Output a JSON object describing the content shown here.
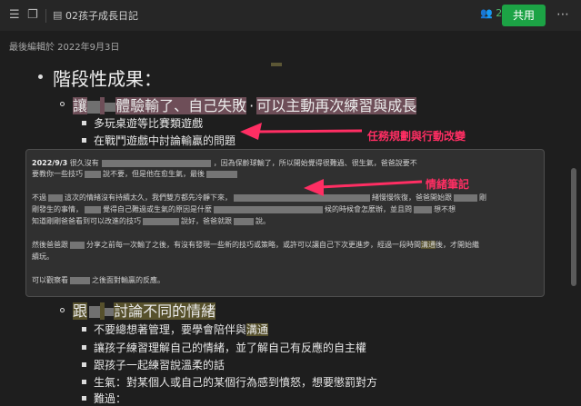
{
  "header": {
    "doc_title": "02孩子成長日記",
    "collaborators_count": "2",
    "share_label": "共用"
  },
  "last_edited": "最後編輯於 2022年9月3日",
  "outline": {
    "heading": "階段性成果：",
    "sub1": {
      "pre": "讓",
      "mid": "體驗輸了、自己失敗",
      "sep": "·",
      "post": "可以主動再次練習與成長"
    },
    "sub1_items": [
      "多玩桌遊等比賽類遊戲",
      "在戰鬥遊戲中討論輸贏的問題"
    ],
    "sub2": {
      "pre": "跟",
      "post": "討論不同的情緒"
    },
    "sub2_items": [
      "不要總想著管理，要學會陪伴與",
      "讓孩子練習理解自己的情緒，並了解自己有反應的自主權",
      "跟孩子一起練習說溫柔的話",
      "生氣：對某個人或自己的某個行為感到憤怒，想要懲罰對方",
      "難過："
    ],
    "sub2_hl": "溝通"
  },
  "note": {
    "date": "2022/9/3",
    "line1a": "很久沒有",
    "line1b": "，因為保齡球輸了，所以開始覺得很難過、很生氣，爸爸說要不",
    "line2a": "要教你一些技巧",
    "line2b": "說不要，但是他在愈生氣，最後",
    "line3a": "不過",
    "line3b": "這次的情緒沒有持續太久，我們雙方都先冷靜下來，",
    "line3c": "緒慢慢恢復，爸爸開始跟",
    "line3d": "剛",
    "line4a": "剛發生的事情，",
    "line4b": "覺得自己難過或生氣的原因是什麼",
    "line4c": "候的時候會怎麼辦，並且問",
    "line4d": "想不想",
    "line5a": "知道剛剛爸爸看到可以改進的技巧",
    "line5b": "說好，爸爸就跟",
    "line5c": "說。",
    "line6a": "然後爸爸跟",
    "line6b": "分享之前每一次輸了之後，有沒有發現一些新的技巧或策略，或許可以讓自己下次更進步，經過一段時間",
    "line6hl": "溝通",
    "line6c": "後，才開始繼",
    "line7": "續玩。",
    "line8a": "可以觀察看",
    "line8b": "之後面對輸贏的反應。"
  },
  "annotations": {
    "task_planning": "任務規劃與行動改變",
    "emotion_note": "情緒筆記"
  },
  "colors": {
    "accent": "#1ca345",
    "annotation": "#ff2e63",
    "highlight_mauve": "#6e4e58",
    "highlight_olive": "#57512c"
  }
}
